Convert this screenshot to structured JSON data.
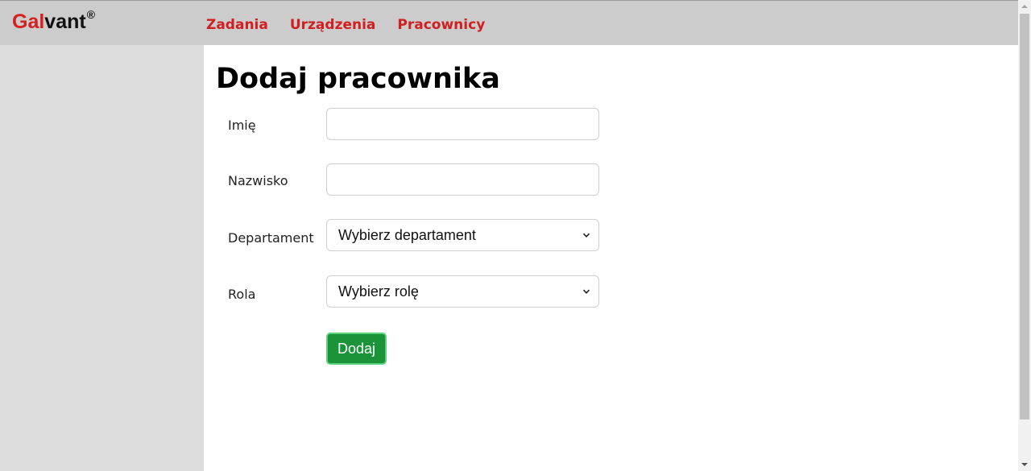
{
  "header": {
    "logo": {
      "part1": "Gal",
      "part2": "vant",
      "mark": "®"
    },
    "nav": [
      {
        "label": "Zadania"
      },
      {
        "label": "Urządzenia"
      },
      {
        "label": "Pracownicy"
      }
    ]
  },
  "form": {
    "title": "Dodaj pracownika",
    "first_name": {
      "label": "Imię",
      "value": ""
    },
    "last_name": {
      "label": "Nazwisko",
      "value": ""
    },
    "department": {
      "label": "Departament",
      "selected": "Wybierz departament"
    },
    "role": {
      "label": "Rola",
      "selected": "Wybierz rolę"
    },
    "submit_label": "Dodaj"
  },
  "colors": {
    "accent_red": "#d01f1f",
    "submit_green": "#1a9339",
    "topbar_bg": "#cccccc",
    "sidebar_bg": "#dddddd"
  },
  "icons": {
    "select_arrow": "chevron-down-icon"
  }
}
